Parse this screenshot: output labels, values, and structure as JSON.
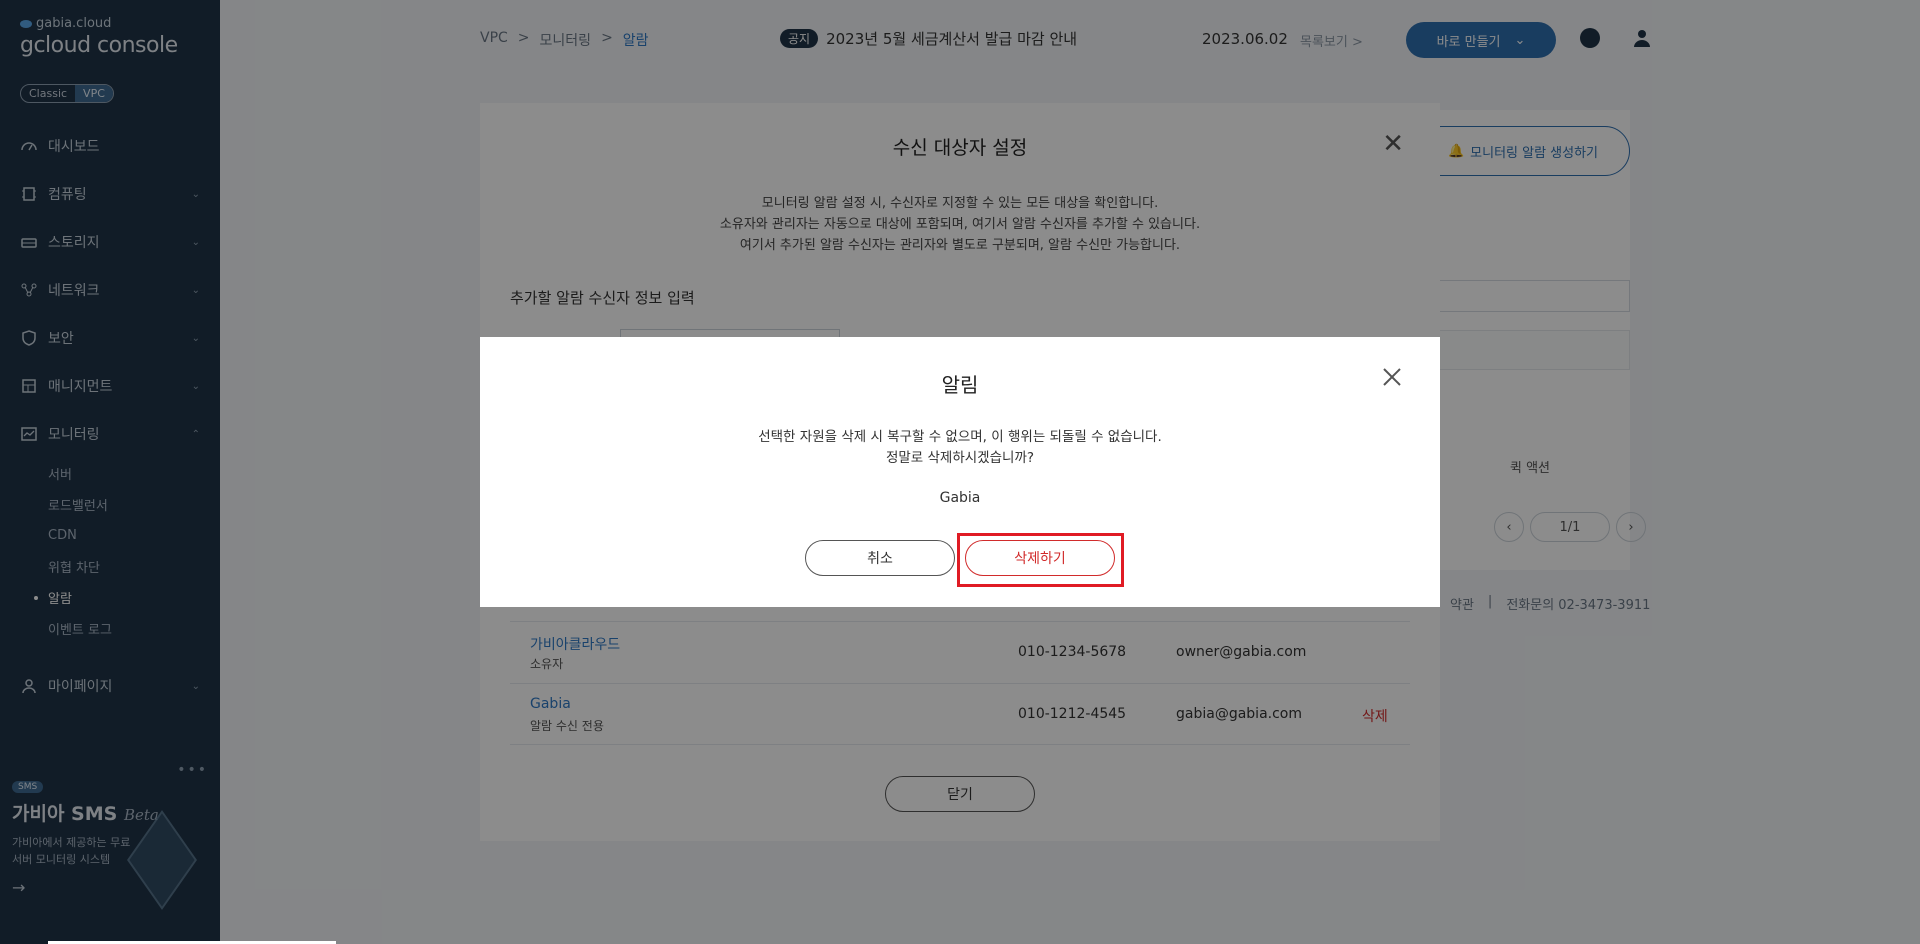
{
  "sidebar": {
    "brand_small": "gabia.cloud",
    "brand_big": "gcloud console",
    "toggle": [
      "Classic",
      "VPC"
    ],
    "items": [
      {
        "label": "대시보드",
        "icon": "speedometer-icon"
      },
      {
        "label": "컴퓨팅",
        "icon": "chip-icon"
      },
      {
        "label": "스토리지",
        "icon": "storage-icon"
      },
      {
        "label": "네트워크",
        "icon": "network-icon"
      },
      {
        "label": "보안",
        "icon": "shield-icon"
      },
      {
        "label": "매니지먼트",
        "icon": "management-icon"
      },
      {
        "label": "모니터링",
        "icon": "monitor-chart-icon"
      }
    ],
    "monitoring_sub": [
      "서버",
      "로드밸런서",
      "CDN",
      "위협 차단",
      "알람",
      "이벤트 로그"
    ],
    "mypage": {
      "label": "마이페이지",
      "icon": "person-icon"
    },
    "promo": {
      "badge": "SMS",
      "title": "가비아 SMS",
      "title_em": "Beta",
      "desc": "가비아에서 제공하는 무료 서버 모니터링 시스템"
    }
  },
  "header": {
    "breadcrumb": [
      "VPC",
      "모니터링",
      "알람"
    ],
    "notice_tag": "공지",
    "notice_text": "2023년 5월 세금계산서 발급 마감 안내",
    "notice_date": "2023.06.02",
    "notice_more": "목록보기 >",
    "create_button": "바로 만들기"
  },
  "background": {
    "alert_create_button": "모니터링 알람 생성하기",
    "quick_action": "퀵 액션",
    "pager": "1/1",
    "footer": [
      "약관",
      "|",
      "전화문의  02-3473-3911"
    ]
  },
  "recipients_modal": {
    "title": "수신 대상자 설정",
    "desc": [
      "모니터링 알람 설정 시, 수신자로 지정할 수 있는 모든 대상을 확인합니다.",
      "소유자와 관리자는 자동으로 대상에 포함되며, 여기서 알람 수신자를 추가할 수 있습니다.",
      "여기서 추가된 알람 수신자는 관리자와 별도로 구분되며, 알람 수신만 가능합니다."
    ],
    "section_title": "추가할 알람 수신자 정보 입력",
    "rows": [
      {
        "name": "가비아클라우드",
        "role": "소유자",
        "phone": "010-1234-5678",
        "email": "owner@gabia.com",
        "action": ""
      },
      {
        "name": "Gabia",
        "role": "알람 수신 전용",
        "phone": "010-1212-4545",
        "email": "gabia@gabia.com",
        "action": "삭제"
      }
    ],
    "close_button": "닫기"
  },
  "alert_dialog": {
    "title": "알림",
    "message_line1": "선택한 자원을 삭제 시 복구할 수 없으며, 이 행위는 되돌릴 수 없습니다.",
    "message_line2": "정말로 삭제하시겠습니까?",
    "resource_name": "Gabia",
    "cancel_button": "취소",
    "delete_button": "삭제하기"
  },
  "colors": {
    "sidebar_bg": "#1f3447",
    "accent": "#2f6fb0",
    "danger": "#d12b2b",
    "highlight": "#e01b24"
  }
}
